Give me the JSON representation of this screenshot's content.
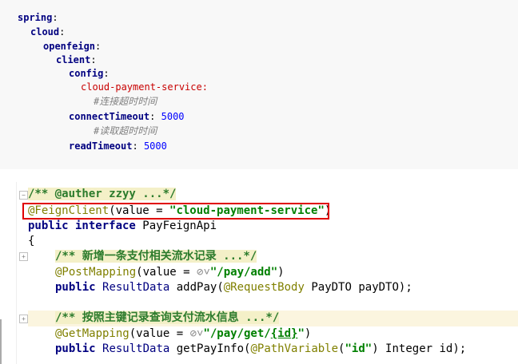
{
  "yaml": {
    "lines": [
      {
        "key": "spring",
        "sep": ":"
      },
      {
        "key": "cloud",
        "sep": ":"
      },
      {
        "key": "openfeign",
        "sep": ":"
      },
      {
        "key": "client",
        "sep": ":"
      },
      {
        "key": "config",
        "sep": ":"
      },
      {
        "key": "cloud-payment-service:"
      },
      {
        "comment": "#连接超时时间"
      },
      {
        "key": "connectTimeout",
        "sep": ":",
        "value": " 5000"
      },
      {
        "comment": "#读取超时时间"
      },
      {
        "key": "readTimeout",
        "sep": ":",
        "value": " 5000"
      }
    ]
  },
  "code": {
    "l1": "/** @auther zzyy ...*/",
    "l2_ann": "@FeignClient",
    "l2_mid": "(value = ",
    "l2_str": "\"cloud-payment-service\"",
    "l2_end": ")",
    "l3_kw": "public interface",
    "l3_name": " PayFeignApi",
    "l4": "{",
    "l5": "/** 新增一条支付相关流水记录 ...*/",
    "l6_ann": "@PostMapping",
    "l6_mid": "(value = ",
    "l6_icon": "⊘˅",
    "l6_str": "\"/pay/add\"",
    "l6_end": ")",
    "l7_kw": "public",
    "l7_type": "ResultData",
    "l7_rest": " addPay(",
    "l7_ann": "@RequestBody",
    "l7_tail": " PayDTO payDTO);",
    "l8": "/** 按照主键记录查询支付流水信息 ...*/",
    "l9_ann": "@GetMapping",
    "l9_mid": "(value = ",
    "l9_icon": "⊘˅",
    "l9_str1": "\"/pay/get/",
    "l9_str2": "{id}",
    "l9_str3": "\"",
    "l9_end": ")",
    "l10_kw": "public",
    "l10_type": "ResultData",
    "l10_rest": " getPayInfo(",
    "l10_ann": "@PathVariable",
    "l10_p1": "(",
    "l10_str": "\"id\"",
    "l10_tail": ") Integer id);"
  }
}
